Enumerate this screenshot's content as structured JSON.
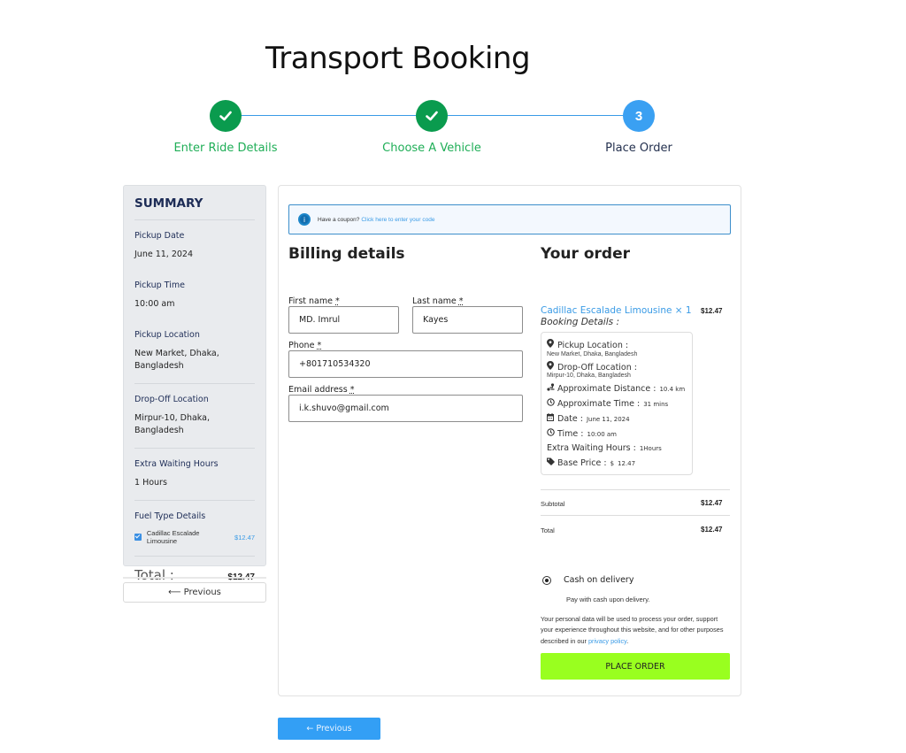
{
  "page": {
    "title": "Transport Booking"
  },
  "stepper": {
    "steps": [
      {
        "label": "Enter Ride Details",
        "state": "done",
        "icon": "check-icon"
      },
      {
        "label": "Choose A Vehicle",
        "state": "done",
        "icon": "check-icon"
      },
      {
        "label": "Place Order",
        "state": "current",
        "number": "3"
      }
    ],
    "colors": {
      "done": "#0a9b4e",
      "current": "#3aa0f2",
      "line": "#3a9be6"
    }
  },
  "summary": {
    "title": "SUMMARY",
    "pickup_date": {
      "label": "Pickup Date",
      "value": "June 11, 2024"
    },
    "pickup_time": {
      "label": "Pickup Time",
      "value": "10:00 am"
    },
    "pickup_location": {
      "label": "Pickup Location",
      "value": "New Market, Dhaka, Bangladesh"
    },
    "dropoff_location": {
      "label": "Drop-Off Location",
      "value": "Mirpur-10, Dhaka, Bangladesh"
    },
    "extra_waiting": {
      "label": "Extra Waiting Hours",
      "value": "1 Hours"
    },
    "fuel": {
      "label": "Fuel Type Details",
      "item_name": "Cadillac Escalade Limousine",
      "item_price": "$12.47",
      "checked": true
    },
    "total": {
      "label": "Total :",
      "value": "$12.47"
    },
    "previous_label": "⟵ Previous"
  },
  "coupon": {
    "question": "Have a coupon?",
    "link": "Click here to enter your code",
    "icon": "info-icon"
  },
  "billing": {
    "title": "Billing details",
    "first_name": {
      "label": "First name",
      "required": "*",
      "value": "MD. Imrul"
    },
    "last_name": {
      "label": "Last name",
      "required": "*",
      "value": "Kayes"
    },
    "phone": {
      "label": "Phone",
      "required": "*",
      "value": "+801710534320"
    },
    "email": {
      "label": "Email address",
      "required": "*",
      "value": "i.k.shuvo@gmail.com"
    }
  },
  "order": {
    "title": "Your order",
    "item": {
      "name": "Cadillac Escalade Limousine",
      "qty": "× 1",
      "price": "$12.47"
    },
    "booking_details_label": "Booking Details :",
    "details": {
      "pickup_location": {
        "label": "Pickup Location :",
        "value": "New Market, Dhaka, Bangladesh",
        "icon": "map-pin-icon"
      },
      "dropoff_location": {
        "label": "Drop-Off Location :",
        "value": "Mirpur-10, Dhaka, Bangladesh",
        "icon": "map-pin-icon"
      },
      "distance": {
        "label": "Approximate Distance :",
        "value": "10.4 km",
        "icon": "route-icon"
      },
      "time_approx": {
        "label": "Approximate Time :",
        "value": "31 mins",
        "icon": "clock-icon"
      },
      "date": {
        "label": "Date :",
        "value": "June 11, 2024",
        "icon": "calendar-icon"
      },
      "time": {
        "label": "Time :",
        "value": "10:00 am",
        "icon": "clock-icon"
      },
      "extra_waiting": {
        "label": "Extra Waiting Hours :",
        "value": "1Hours"
      },
      "base_price": {
        "label": "Base Price :",
        "currency": "$",
        "value": "12.47",
        "icon": "tag-icon"
      }
    },
    "subtotal": {
      "label": "Subtotal",
      "value": "$12.47"
    },
    "total": {
      "label": "Total",
      "value": "$12.47"
    },
    "payment": {
      "method": "Cash on delivery",
      "description": "Pay with cash upon delivery.",
      "selected": true
    },
    "privacy_text": "Your personal data will be used to process your order, support your experience throughout this website, and for other purposes described in our",
    "privacy_link": "privacy policy",
    "privacy_end": ".",
    "place_order_label": "PLACE ORDER",
    "place_order_color": "#99ff1f"
  },
  "footer": {
    "previous_label": "← Previous",
    "previous_color": "#339ff5"
  }
}
